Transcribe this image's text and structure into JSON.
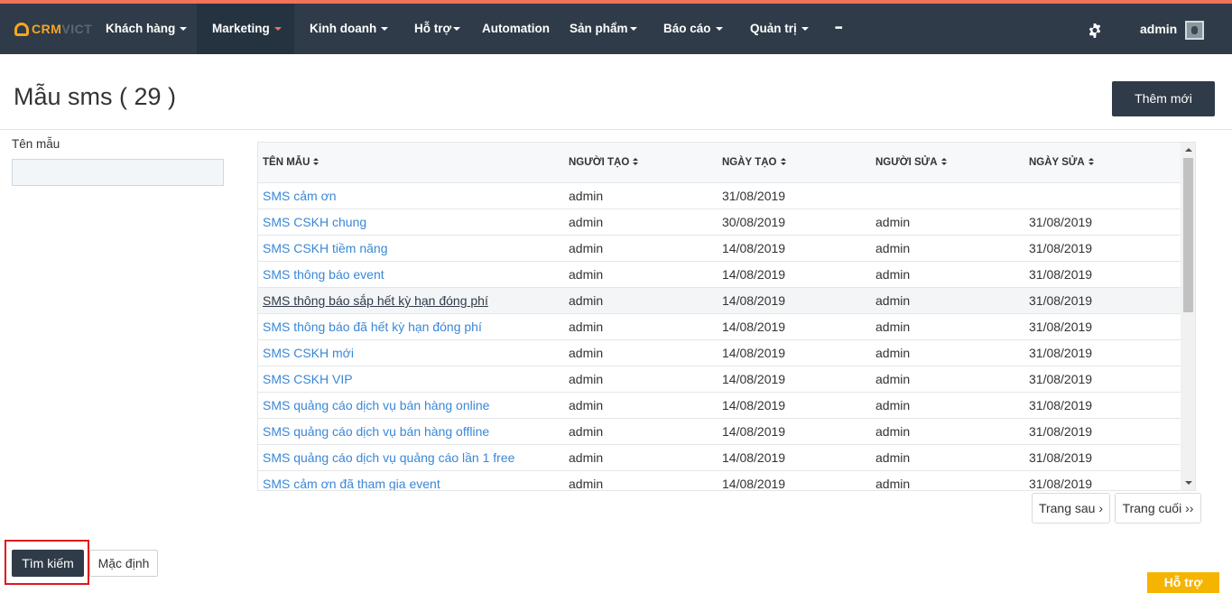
{
  "brand": {
    "logo_part1": "CRM",
    "logo_part2": "VICT",
    "accent_color": "#f5a623",
    "nav_bg": "#2f3b48"
  },
  "nav": {
    "items": [
      {
        "label": "Khách hàng"
      },
      {
        "label": "Marketing"
      },
      {
        "label": "Kinh doanh"
      },
      {
        "label": "Hỗ trợ"
      },
      {
        "label": "Automation"
      },
      {
        "label": "Sản phẩm"
      },
      {
        "label": "Báo cáo"
      },
      {
        "label": "Quản trị"
      },
      {
        "label": "•••"
      }
    ],
    "active": "Marketing",
    "settings_icon": "gear-icon",
    "user_name": "admin"
  },
  "page": {
    "title": "Mẫu sms ( 29 )",
    "add_button": "Thêm mới"
  },
  "filter": {
    "name_label": "Tên mẫu",
    "name_value": "",
    "search_button": "Tìm kiếm",
    "default_button": "Mặc định"
  },
  "table": {
    "columns": [
      "TÊN MẪU",
      "NGƯỜI TẠO",
      "NGÀY TẠO",
      "NGƯỜI SỬA",
      "NGÀY SỬA"
    ],
    "rows": [
      {
        "name": "SMS cảm ơn",
        "creator": "admin",
        "created": "31/08/2019",
        "editor": "",
        "edited": ""
      },
      {
        "name": "SMS CSKH chung",
        "creator": "admin",
        "created": "30/08/2019",
        "editor": "admin",
        "edited": "31/08/2019"
      },
      {
        "name": "SMS CSKH tiềm năng",
        "creator": "admin",
        "created": "14/08/2019",
        "editor": "admin",
        "edited": "31/08/2019"
      },
      {
        "name": "SMS thông báo event",
        "creator": "admin",
        "created": "14/08/2019",
        "editor": "admin",
        "edited": "31/08/2019"
      },
      {
        "name": "SMS thông báo sắp hết kỳ hạn đóng phí",
        "creator": "admin",
        "created": "14/08/2019",
        "editor": "admin",
        "edited": "31/08/2019"
      },
      {
        "name": "SMS thông báo đã hết kỳ hạn đóng phí",
        "creator": "admin",
        "created": "14/08/2019",
        "editor": "admin",
        "edited": "31/08/2019"
      },
      {
        "name": "SMS CSKH mới",
        "creator": "admin",
        "created": "14/08/2019",
        "editor": "admin",
        "edited": "31/08/2019"
      },
      {
        "name": "SMS CSKH VIP",
        "creator": "admin",
        "created": "14/08/2019",
        "editor": "admin",
        "edited": "31/08/2019"
      },
      {
        "name": "SMS quảng cáo dịch vụ bán hàng online",
        "creator": "admin",
        "created": "14/08/2019",
        "editor": "admin",
        "edited": "31/08/2019"
      },
      {
        "name": "SMS quảng cáo dịch vụ bán hàng offline",
        "creator": "admin",
        "created": "14/08/2019",
        "editor": "admin",
        "edited": "31/08/2019"
      },
      {
        "name": "SMS quảng cáo dịch vụ quảng cáo lần 1 free",
        "creator": "admin",
        "created": "14/08/2019",
        "editor": "admin",
        "edited": "31/08/2019"
      },
      {
        "name": "SMS cảm ơn đã tham gia event",
        "creator": "admin",
        "created": "14/08/2019",
        "editor": "admin",
        "edited": "31/08/2019"
      }
    ],
    "hovered_row": "SMS thông báo sắp hết kỳ hạn đóng phí"
  },
  "pagination": {
    "next": "Trang sau ›",
    "last": "Trang cuối ››"
  },
  "support_tab": "Hỗ trợ"
}
